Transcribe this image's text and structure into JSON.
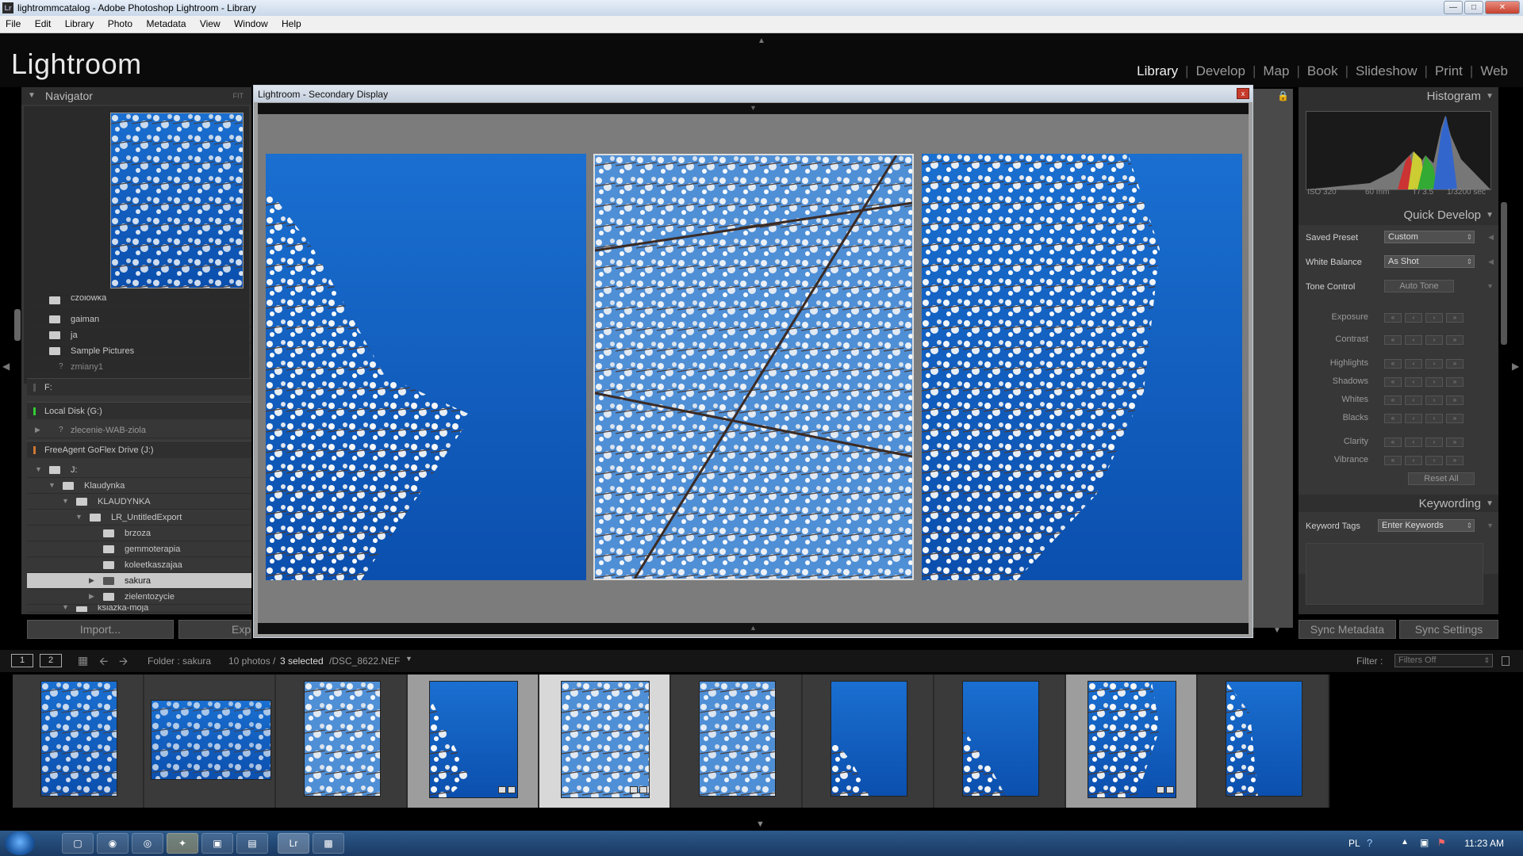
{
  "window": {
    "title": "lightrommcatalog - Adobe Photoshop Lightroom - Library",
    "app_icon": "Lr"
  },
  "menu": [
    "File",
    "Edit",
    "Library",
    "Photo",
    "Metadata",
    "View",
    "Window",
    "Help"
  ],
  "header": {
    "logo": "Lightroom",
    "modules": [
      "Library",
      "Develop",
      "Map",
      "Book",
      "Slideshow",
      "Print",
      "Web"
    ],
    "active_module": "Library"
  },
  "navigator": {
    "title": "Navigator",
    "zoom": "FIT"
  },
  "folders": {
    "top_items": [
      {
        "label": "czolowka"
      },
      {
        "label": "gaiman"
      },
      {
        "label": "ja"
      },
      {
        "label": "Sample Pictures"
      },
      {
        "label": "zmiany1"
      }
    ],
    "vol_f": "F:",
    "vol_g": "Local Disk (G:)",
    "g_item": "zlecenie-WAB-ziola",
    "vol_j": "FreeAgent GoFlex Drive (J:)",
    "tree": [
      {
        "label": "J:"
      },
      {
        "label": "Klaudynka"
      },
      {
        "label": "KLAUDYNKA"
      },
      {
        "label": "LR_UntitledExport"
      },
      {
        "label": "brzoza"
      },
      {
        "label": "gemmoterapia"
      },
      {
        "label": "koleetkaszajaa"
      },
      {
        "label": "sakura"
      },
      {
        "label": "zielentozycie"
      },
      {
        "label": "ksiazka-moja"
      }
    ]
  },
  "left_buttons": {
    "import": "Import...",
    "export": "Exp"
  },
  "secondary": {
    "title": "Lightroom - Secondary Display",
    "close": "x"
  },
  "histogram": {
    "title": "Histogram",
    "iso": "ISO 320",
    "focal": "60 mm",
    "aperture": "f / 3.5",
    "shutter": "1/3200 sec"
  },
  "quick_develop": {
    "title": "Quick Develop",
    "saved_preset_label": "Saved Preset",
    "saved_preset_value": "Custom",
    "white_balance_label": "White Balance",
    "white_balance_value": "As Shot",
    "tone_control_label": "Tone Control",
    "auto_tone": "Auto Tone",
    "adjustments": [
      "Exposure",
      "Contrast",
      "Highlights",
      "Shadows",
      "Whites",
      "Blacks",
      "Clarity",
      "Vibrance"
    ],
    "reset_all": "Reset All"
  },
  "keywording": {
    "title": "Keywording",
    "keyword_tags_label": "Keyword Tags",
    "keyword_tags_value": "Enter Keywords"
  },
  "right_buttons": {
    "sync_metadata": "Sync Metadata",
    "sync_settings": "Sync Settings"
  },
  "filmstrip_bar": {
    "view1": "1",
    "view2": "2",
    "folder": "Folder : sakura",
    "count": "10 photos /",
    "selected": "3 selected",
    "file": "/DSC_8622.NEF",
    "filter_label": "Filter :",
    "filter_value": "Filters Off"
  },
  "taskbar": {
    "lang": "PL",
    "time": "11:23 AM",
    "apps": [
      "Lr"
    ]
  },
  "colors": {
    "accent_sky": "#1763c4",
    "panel": "#373737",
    "selected_cell": "#d8d8d8"
  }
}
